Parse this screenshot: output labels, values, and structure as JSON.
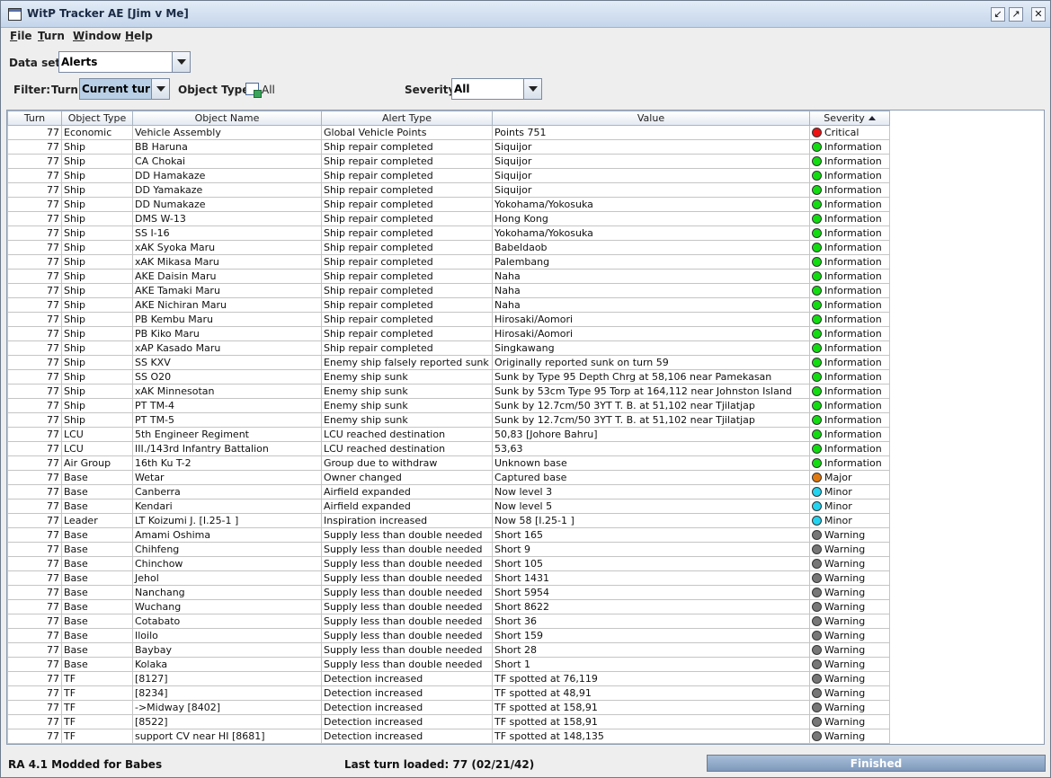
{
  "window": {
    "title": "WitP Tracker AE [Jim v Me]"
  },
  "menu": [
    {
      "mnemonic": "F",
      "rest": "ile"
    },
    {
      "mnemonic": "T",
      "rest": "urn"
    },
    {
      "mnemonic": "W",
      "rest": "indow"
    },
    {
      "mnemonic": "H",
      "rest": "elp"
    }
  ],
  "toolbar": {
    "dataset_label": "Data set:",
    "dataset_value": "Alerts",
    "filter_label": "Filter:",
    "turn_label": "Turn:",
    "turn_value": "Current turn",
    "objtype_label": "Object Type:",
    "objtype_value": "All",
    "severity_label": "Severity:",
    "severity_value": "All"
  },
  "table": {
    "columns": [
      "Turn",
      "Object Type",
      "Object Name",
      "Alert Type",
      "Value",
      "Severity"
    ],
    "rows": [
      [
        "77",
        "Economic",
        "Vehicle Assembly",
        "Global Vehicle Points",
        "Points 751",
        "Critical"
      ],
      [
        "77",
        "Ship",
        "BB Haruna",
        "Ship repair completed",
        "Siquijor",
        "Information"
      ],
      [
        "77",
        "Ship",
        "CA Chokai",
        "Ship repair completed",
        "Siquijor",
        "Information"
      ],
      [
        "77",
        "Ship",
        "DD Hamakaze",
        "Ship repair completed",
        "Siquijor",
        "Information"
      ],
      [
        "77",
        "Ship",
        "DD Yamakaze",
        "Ship repair completed",
        "Siquijor",
        "Information"
      ],
      [
        "77",
        "Ship",
        "DD Numakaze",
        "Ship repair completed",
        "Yokohama/Yokosuka",
        "Information"
      ],
      [
        "77",
        "Ship",
        "DMS W-13",
        "Ship repair completed",
        "Hong Kong",
        "Information"
      ],
      [
        "77",
        "Ship",
        "SS I-16",
        "Ship repair completed",
        "Yokohama/Yokosuka",
        "Information"
      ],
      [
        "77",
        "Ship",
        "xAK Syoka Maru",
        "Ship repair completed",
        "Babeldaob",
        "Information"
      ],
      [
        "77",
        "Ship",
        "xAK Mikasa Maru",
        "Ship repair completed",
        "Palembang",
        "Information"
      ],
      [
        "77",
        "Ship",
        "AKE Daisin Maru",
        "Ship repair completed",
        "Naha",
        "Information"
      ],
      [
        "77",
        "Ship",
        "AKE Tamaki Maru",
        "Ship repair completed",
        "Naha",
        "Information"
      ],
      [
        "77",
        "Ship",
        "AKE Nichiran Maru",
        "Ship repair completed",
        "Naha",
        "Information"
      ],
      [
        "77",
        "Ship",
        "PB Kembu Maru",
        "Ship repair completed",
        "Hirosaki/Aomori",
        "Information"
      ],
      [
        "77",
        "Ship",
        "PB Kiko Maru",
        "Ship repair completed",
        "Hirosaki/Aomori",
        "Information"
      ],
      [
        "77",
        "Ship",
        "xAP Kasado Maru",
        "Ship repair completed",
        "Singkawang",
        "Information"
      ],
      [
        "77",
        "Ship",
        "SS KXV",
        "Enemy ship falsely reported sunk",
        "Originally reported sunk on turn 59",
        "Information"
      ],
      [
        "77",
        "Ship",
        "SS O20",
        "Enemy ship sunk",
        "Sunk by Type 95 Depth Chrg at 58,106 near Pamekasan",
        "Information"
      ],
      [
        "77",
        "Ship",
        "xAK Minnesotan",
        "Enemy ship sunk",
        "Sunk by 53cm Type 95 Torp at 164,112 near Johnston Island",
        "Information"
      ],
      [
        "77",
        "Ship",
        "PT TM-4",
        "Enemy ship sunk",
        "Sunk by 12.7cm/50 3YT T. B. at 51,102 near Tjilatjap",
        "Information"
      ],
      [
        "77",
        "Ship",
        "PT TM-5",
        "Enemy ship sunk",
        "Sunk by 12.7cm/50 3YT T. B. at 51,102 near Tjilatjap",
        "Information"
      ],
      [
        "77",
        "LCU",
        "5th Engineer Regiment",
        "LCU reached destination",
        "50,83 [Johore Bahru]",
        "Information"
      ],
      [
        "77",
        "LCU",
        "III./143rd Infantry Battalion",
        "LCU reached destination",
        "53,63",
        "Information"
      ],
      [
        "77",
        "Air Group",
        "16th Ku T-2",
        "Group due to withdraw",
        "Unknown base",
        "Information"
      ],
      [
        "77",
        "Base",
        "Wetar",
        "Owner changed",
        "Captured base",
        "Major"
      ],
      [
        "77",
        "Base",
        "Canberra",
        "Airfield expanded",
        "Now level 3",
        "Minor"
      ],
      [
        "77",
        "Base",
        "Kendari",
        "Airfield expanded",
        "Now level 5",
        "Minor"
      ],
      [
        "77",
        "Leader",
        "LT Koizumi J. [I.25-1 ]",
        "Inspiration increased",
        "Now 58 [I.25-1 ]",
        "Minor"
      ],
      [
        "77",
        "Base",
        "Amami Oshima",
        "Supply less than double needed",
        "Short 165",
        "Warning"
      ],
      [
        "77",
        "Base",
        "Chihfeng",
        "Supply less than double needed",
        "Short 9",
        "Warning"
      ],
      [
        "77",
        "Base",
        "Chinchow",
        "Supply less than double needed",
        "Short 105",
        "Warning"
      ],
      [
        "77",
        "Base",
        "Jehol",
        "Supply less than double needed",
        "Short 1431",
        "Warning"
      ],
      [
        "77",
        "Base",
        "Nanchang",
        "Supply less than double needed",
        "Short 5954",
        "Warning"
      ],
      [
        "77",
        "Base",
        "Wuchang",
        "Supply less than double needed",
        "Short 8622",
        "Warning"
      ],
      [
        "77",
        "Base",
        "Cotabato",
        "Supply less than double needed",
        "Short 36",
        "Warning"
      ],
      [
        "77",
        "Base",
        "Iloilo",
        "Supply less than double needed",
        "Short 159",
        "Warning"
      ],
      [
        "77",
        "Base",
        "Baybay",
        "Supply less than double needed",
        "Short 28",
        "Warning"
      ],
      [
        "77",
        "Base",
        "Kolaka",
        "Supply less than double needed",
        "Short 1",
        "Warning"
      ],
      [
        "77",
        "TF",
        " [8127]",
        "Detection increased",
        "TF spotted at 76,119",
        "Warning"
      ],
      [
        "77",
        "TF",
        " [8234]",
        "Detection increased",
        "TF spotted at 48,91",
        "Warning"
      ],
      [
        "77",
        "TF",
        "->Midway [8402]",
        "Detection increased",
        "TF spotted at 158,91",
        "Warning"
      ],
      [
        "77",
        "TF",
        " [8522]",
        "Detection increased",
        "TF spotted at 158,91",
        "Warning"
      ],
      [
        "77",
        "TF",
        "support CV near HI [8681]",
        "Detection increased",
        "TF spotted at 148,135",
        "Warning"
      ]
    ]
  },
  "severity_colors": {
    "Critical": "#ee1111",
    "Information": "#11dd11",
    "Major": "#e07a10",
    "Minor": "#22d4f0",
    "Warning": "#777777"
  },
  "status": {
    "left": "RA 4.1 Modded for Babes",
    "middle": "Last turn loaded: 77 (02/21/42)",
    "progress_label": "Finished",
    "progress_fraction": 1.0
  }
}
